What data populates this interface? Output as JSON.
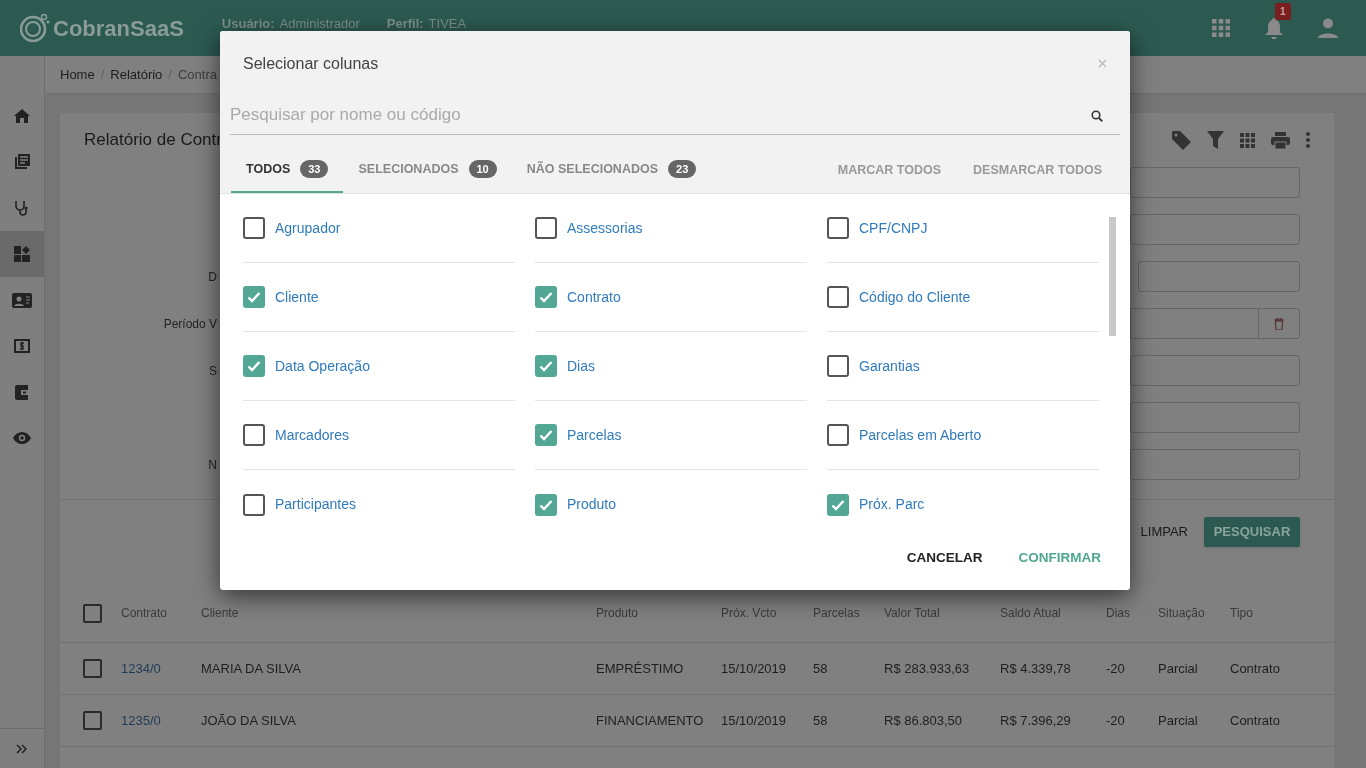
{
  "header": {
    "logo": "CobranSaaS",
    "user_label": "Usuário:",
    "user_value": "Administrador",
    "profile_label": "Perfil:",
    "profile_value": "TIVEA",
    "notification_count": "1"
  },
  "sidebar": {
    "items": [
      {
        "kind": "home",
        "selected": false
      },
      {
        "kind": "library",
        "selected": false
      },
      {
        "kind": "stethoscope",
        "selected": false
      },
      {
        "kind": "dashboard",
        "selected": true
      },
      {
        "kind": "contact",
        "selected": false
      },
      {
        "kind": "money",
        "selected": false
      },
      {
        "kind": "wallet",
        "selected": false
      },
      {
        "kind": "eye",
        "selected": false
      }
    ]
  },
  "breadcrumb": [
    {
      "label": "Home",
      "separator": "/"
    },
    {
      "label": "Relatório",
      "separator": "/"
    },
    {
      "label": "Contra"
    }
  ],
  "card": {
    "title": "Relatório de Contr",
    "form_rows": [
      {
        "kind": "text"
      },
      {
        "kind": "text"
      },
      {
        "kind": "short",
        "label": "D"
      },
      {
        "kind": "clearable",
        "label": "Período V"
      },
      {
        "kind": "text",
        "label": "S"
      },
      {
        "kind": "text"
      },
      {
        "kind": "text",
        "label": "N"
      }
    ],
    "actions": [
      {
        "kind": "text",
        "label": "LIMPAR"
      },
      {
        "kind": "primary",
        "label": "PESQUISAR"
      }
    ]
  },
  "table": {
    "select_all": {
      "checked": false
    },
    "columns": [
      "Contrato",
      "Cliente",
      "Produto",
      "Próx. Vcto",
      "Parcelas",
      "Valor Total",
      "Saldo Atual",
      "Dias",
      "Situação",
      "Tipo"
    ],
    "rows": [
      {
        "checked": false,
        "cells": [
          "1234/0",
          "MARIA DA SILVA",
          "EMPRÉSTIMO",
          "15/10/2019",
          "58",
          "R$ 283.933,63",
          "R$ 4.339,78",
          "-20",
          "Parcial",
          "Contrato"
        ]
      },
      {
        "checked": false,
        "cells": [
          "1235/0",
          "JOÃO DA SILVA",
          "FINANCIAMENTO",
          "15/10/2019",
          "58",
          "R$ 86.803,50",
          "R$ 7.396,29",
          "-20",
          "Parcial",
          "Contrato"
        ]
      }
    ]
  },
  "modal": {
    "title": "Selecionar colunas",
    "search": {
      "placeholder": "Pesquisar por nome ou código"
    },
    "tabs": [
      {
        "label": "TODOS",
        "count": "33",
        "selected": true
      },
      {
        "label": "SELECIONADOS",
        "count": "10",
        "selected": false
      },
      {
        "label": "NÃO SELECIONADOS",
        "count": "23",
        "selected": false
      }
    ],
    "bulk_actions": [
      "MARCAR TODOS",
      "DESMARCAR TODOS"
    ],
    "options": [
      {
        "label": "Agrupador",
        "checked": false
      },
      {
        "label": "Assessorias",
        "checked": false
      },
      {
        "label": "CPF/CNPJ",
        "checked": false
      },
      {
        "label": "Cliente",
        "checked": true
      },
      {
        "label": "Contrato",
        "checked": true
      },
      {
        "label": "Código do Cliente",
        "checked": false
      },
      {
        "label": "Data Operação",
        "checked": true
      },
      {
        "label": "Dias",
        "checked": true
      },
      {
        "label": "Garantias",
        "checked": false
      },
      {
        "label": "Marcadores",
        "checked": false
      },
      {
        "label": "Parcelas",
        "checked": true
      },
      {
        "label": "Parcelas em Aberto",
        "checked": false
      },
      {
        "label": "Participantes",
        "checked": false
      },
      {
        "label": "Produto",
        "checked": true
      },
      {
        "label": "Próx. Parc",
        "checked": true
      }
    ],
    "buttons": [
      {
        "kind": "cancel",
        "label": "CANCELAR"
      },
      {
        "kind": "confirm",
        "label": "CONFIRMAR"
      }
    ]
  }
}
